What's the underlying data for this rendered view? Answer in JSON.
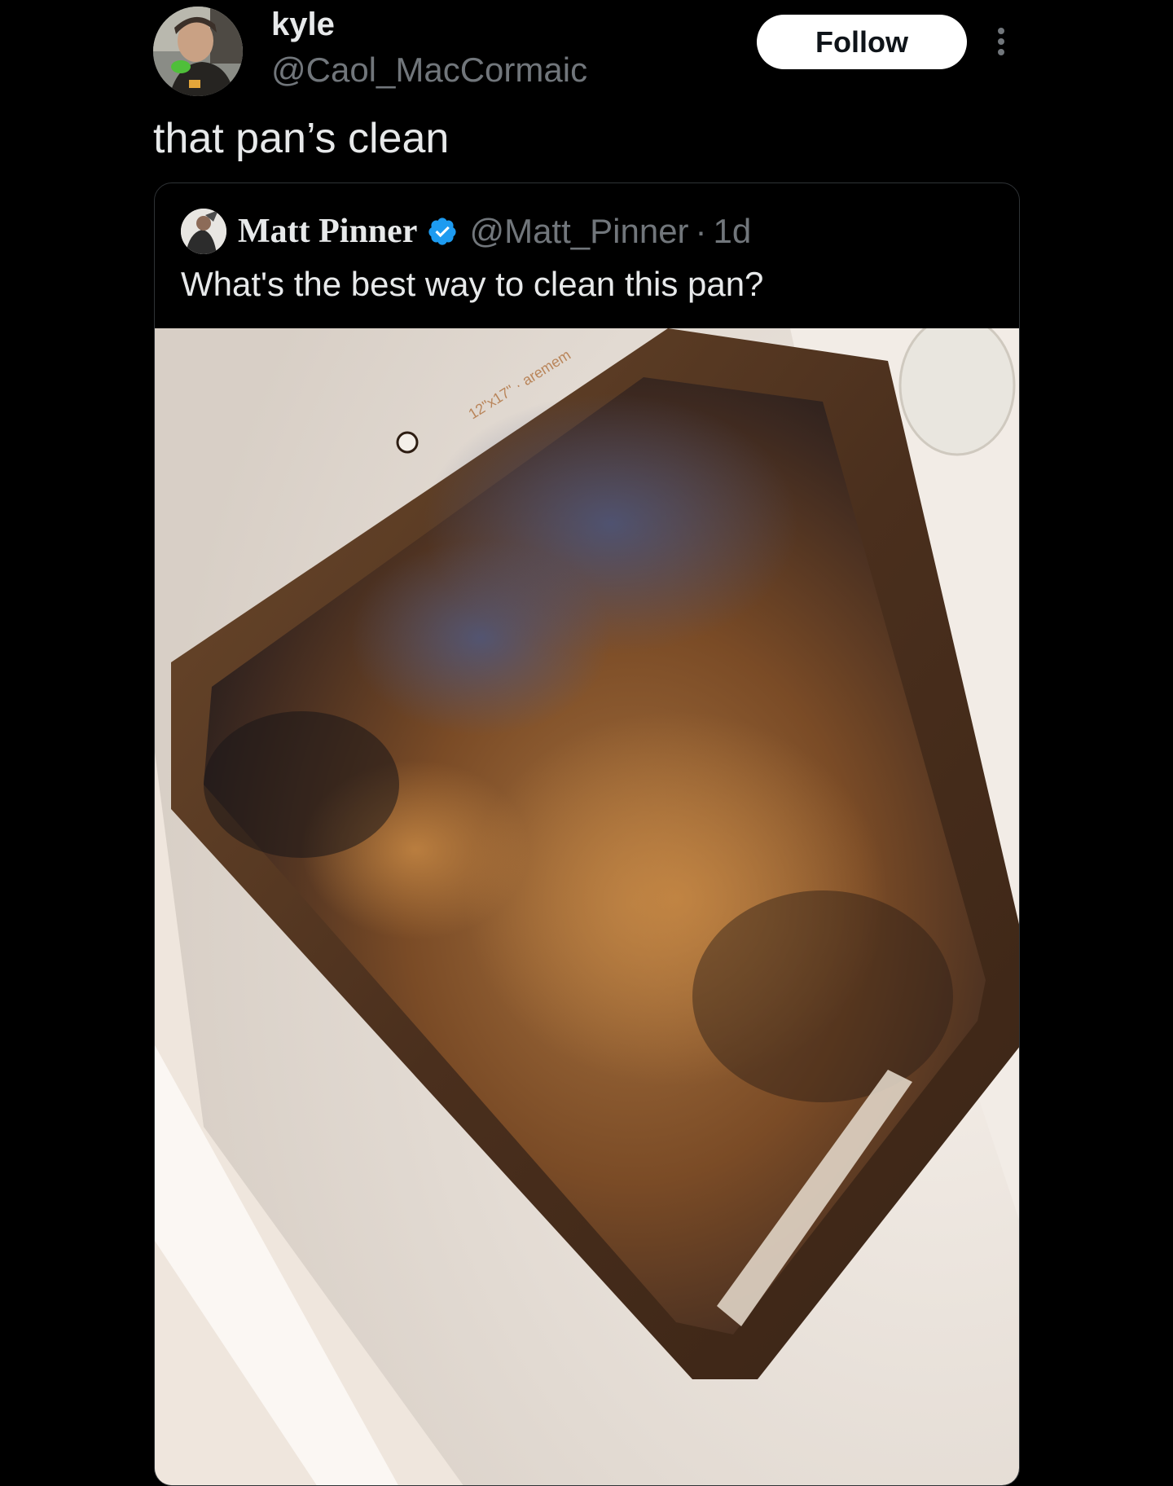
{
  "author": {
    "name": "kyle",
    "handle": "@Caol_MacCormaic",
    "follow_label": "Follow"
  },
  "post": {
    "text": "that pan’s clean"
  },
  "quoted_post": {
    "name": "Matt Pinner",
    "handle": "@Matt_Pinner",
    "separator": "·",
    "time": "1d",
    "text": "What's the best way to clean this pan?",
    "pan_stamp": "12\"x17\" · aremem"
  },
  "colors": {
    "background": "#000000",
    "text_primary": "#e7e9ea",
    "text_secondary": "#71767b",
    "follow_bg": "#ffffff",
    "verified": "#1d9bf0",
    "card_border": "#2f3336"
  },
  "icons": {
    "verified": "verified-badge-icon",
    "more": "more-vertical-icon"
  }
}
